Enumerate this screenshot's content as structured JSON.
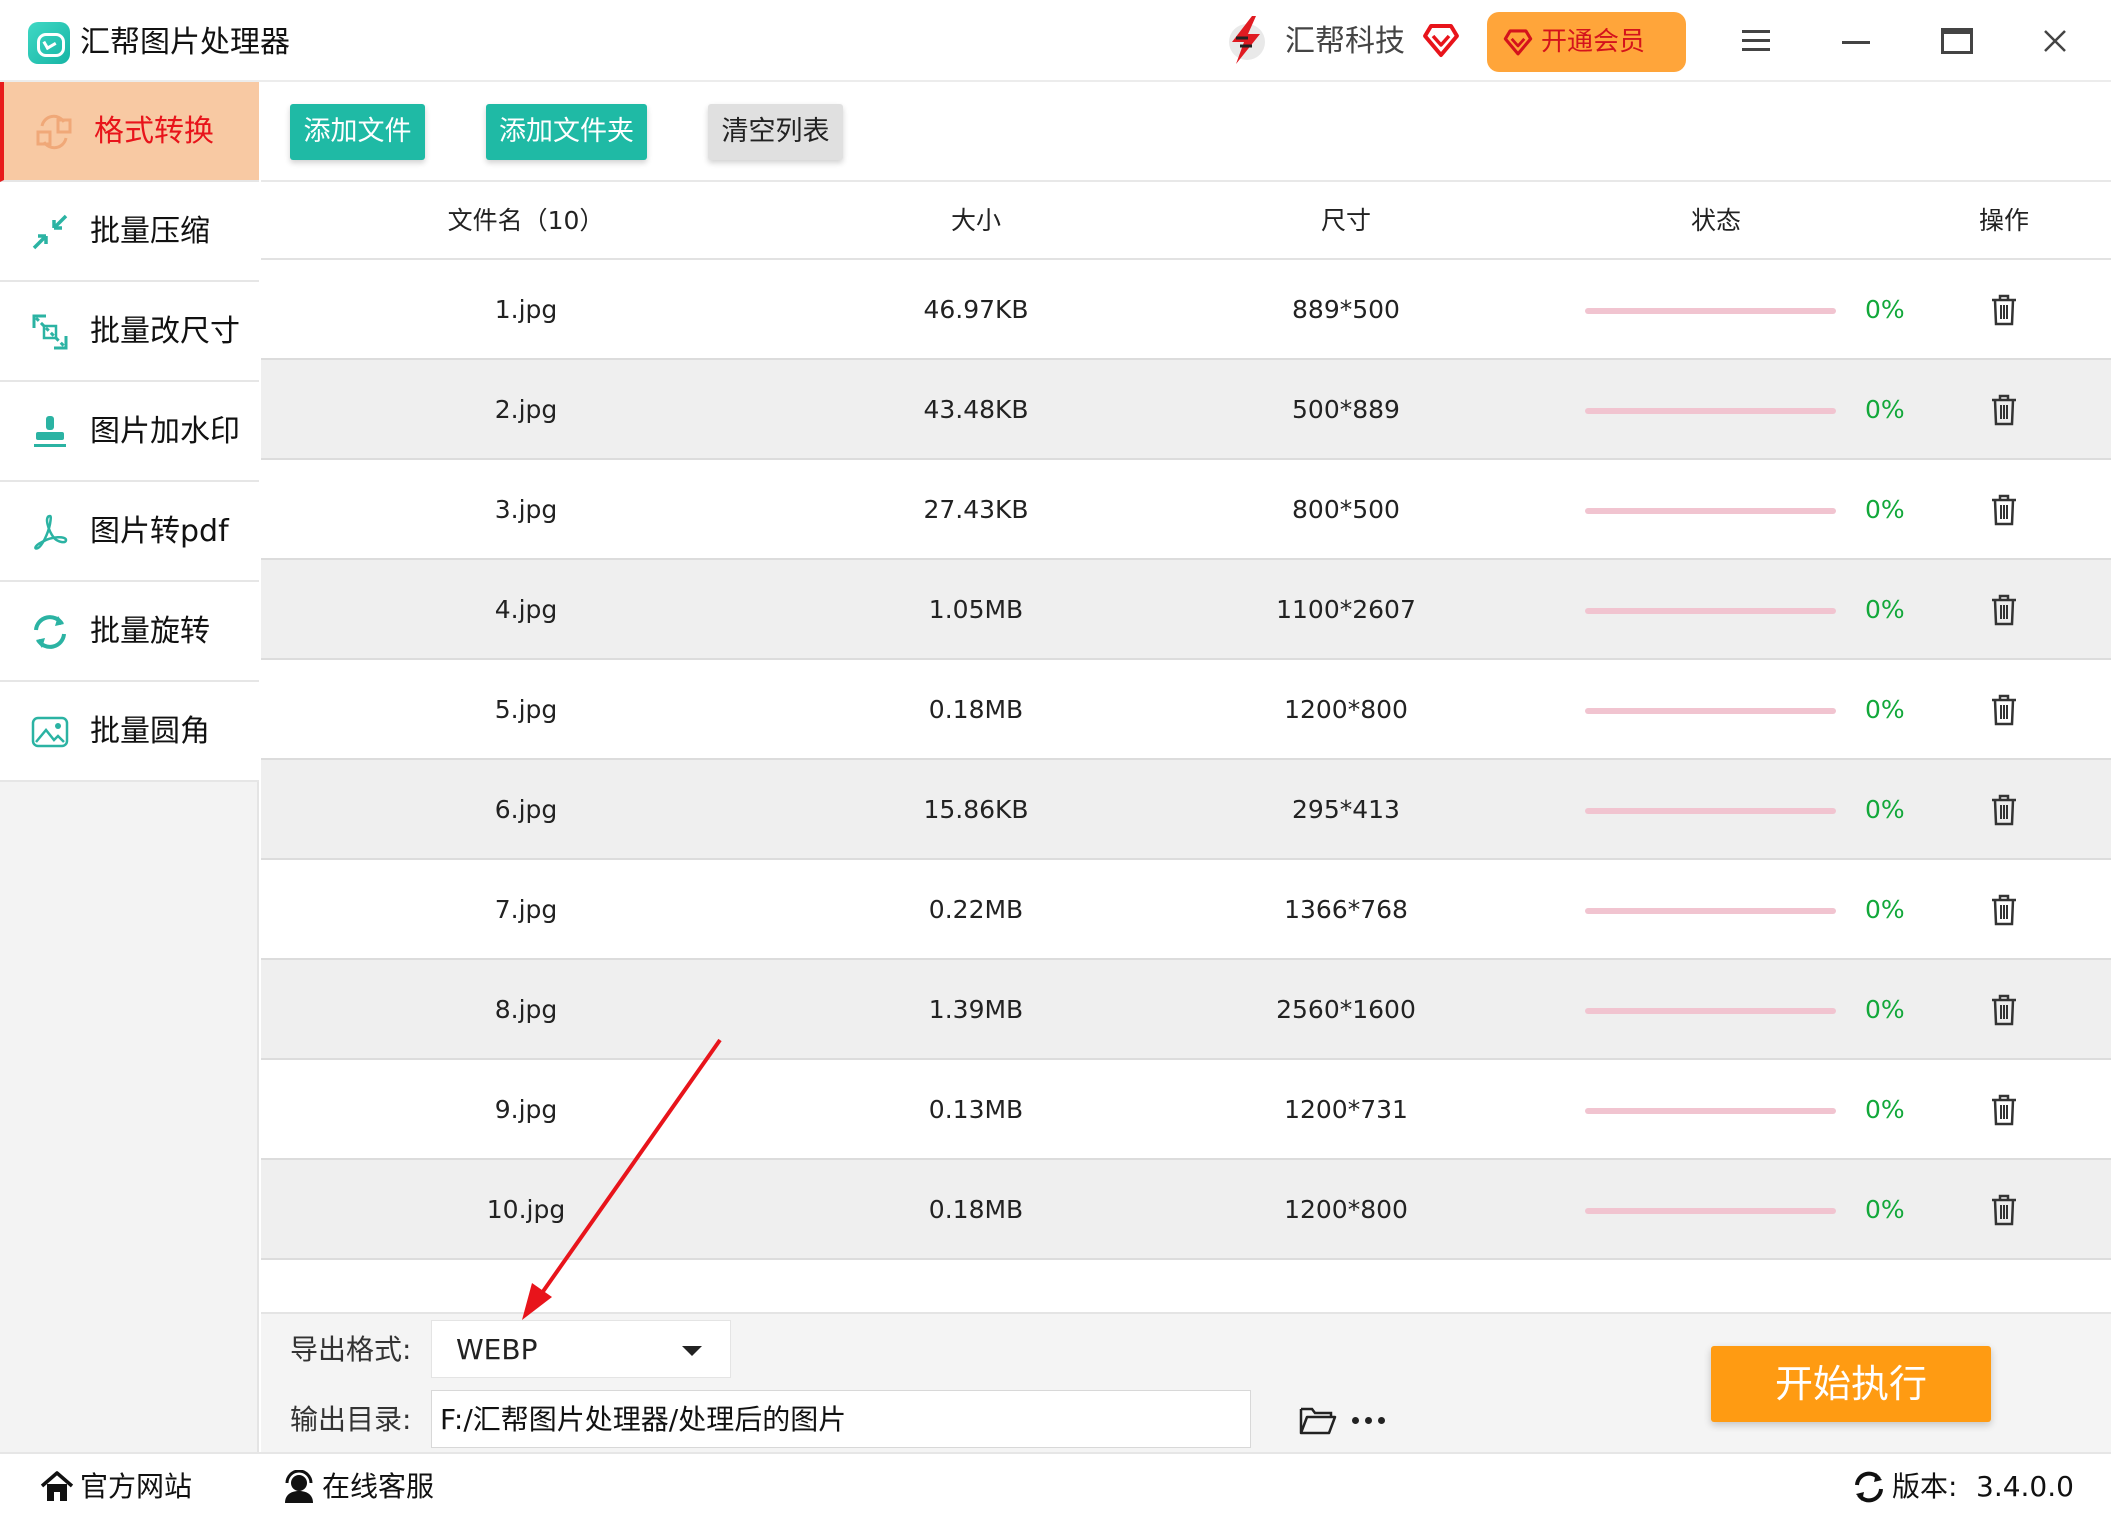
{
  "app": {
    "title": "汇帮图片处理器",
    "brand_name": "汇帮科技",
    "vip_button_label": "开通会员",
    "accent_color": "#1fbaa5",
    "vip_color": "#ffa53a"
  },
  "sidebar": {
    "items": [
      {
        "label": "格式转换",
        "icon": "convert-icon",
        "active": true
      },
      {
        "label": "批量压缩",
        "icon": "compress-icon",
        "active": false
      },
      {
        "label": "批量改尺寸",
        "icon": "resize-icon",
        "active": false
      },
      {
        "label": "图片加水印",
        "icon": "watermark-icon",
        "active": false
      },
      {
        "label": "图片转pdf",
        "icon": "pdf-icon",
        "active": false
      },
      {
        "label": "批量旋转",
        "icon": "rotate-icon",
        "active": false
      },
      {
        "label": "批量圆角",
        "icon": "rounded-corner-icon",
        "active": false
      }
    ]
  },
  "toolbar": {
    "add_file": "添加文件",
    "add_folder": "添加文件夹",
    "clear_list": "清空列表"
  },
  "table": {
    "headers": {
      "filename": "文件名（10）",
      "size": "大小",
      "dimensions": "尺寸",
      "status": "状态",
      "action": "操作"
    },
    "rows": [
      {
        "name": "1.jpg",
        "size": "46.97KB",
        "dimensions": "889*500",
        "progress": "0%"
      },
      {
        "name": "2.jpg",
        "size": "43.48KB",
        "dimensions": "500*889",
        "progress": "0%"
      },
      {
        "name": "3.jpg",
        "size": "27.43KB",
        "dimensions": "800*500",
        "progress": "0%"
      },
      {
        "name": "4.jpg",
        "size": "1.05MB",
        "dimensions": "1100*2607",
        "progress": "0%"
      },
      {
        "name": "5.jpg",
        "size": "0.18MB",
        "dimensions": "1200*800",
        "progress": "0%"
      },
      {
        "name": "6.jpg",
        "size": "15.86KB",
        "dimensions": "295*413",
        "progress": "0%"
      },
      {
        "name": "7.jpg",
        "size": "0.22MB",
        "dimensions": "1366*768",
        "progress": "0%"
      },
      {
        "name": "8.jpg",
        "size": "1.39MB",
        "dimensions": "2560*1600",
        "progress": "0%"
      },
      {
        "name": "9.jpg",
        "size": "0.13MB",
        "dimensions": "1200*731",
        "progress": "0%"
      },
      {
        "name": "10.jpg",
        "size": "0.18MB",
        "dimensions": "1200*800",
        "progress": "0%"
      }
    ]
  },
  "settings": {
    "format_label": "导出格式:",
    "format_value": "WEBP",
    "output_label": "输出目录:",
    "output_path": "F:/汇帮图片处理器/处理后的图片",
    "start_button": "开始执行"
  },
  "footer": {
    "website": "官方网站",
    "support": "在线客服",
    "version_label": "版本:",
    "version": "3.4.0.0"
  }
}
